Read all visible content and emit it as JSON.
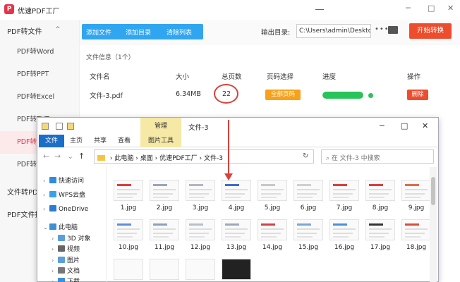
{
  "app": {
    "title": "优速PDF工厂",
    "logo_glyph": "P",
    "brand_color": "#e5344a",
    "window_controls": [
      "─",
      "□",
      "✕"
    ]
  },
  "sidebar": {
    "groups": [
      {
        "label": "PDF转文件",
        "expanded": true
      },
      {
        "label": "文件转PDF"
      },
      {
        "label": "PDF文件操作"
      }
    ],
    "items": [
      {
        "label": "PDF转Word"
      },
      {
        "label": "PDF转PPT"
      },
      {
        "label": "PDF转Excel"
      },
      {
        "label": "PDF转TXT"
      },
      {
        "label": "PDF转图片",
        "active": true
      },
      {
        "label": "PDF转HTML"
      }
    ],
    "chevron": "^"
  },
  "toolbar": {
    "add_file": "添加文件",
    "add_folder": "添加目录",
    "clear_list": "清除列表",
    "output_label": "输出目录:",
    "output_path": "C:\\Users\\admin\\Desktop",
    "more": "•••",
    "start": "开始转换"
  },
  "file_info": {
    "label": "文件信息（1个）",
    "headers": {
      "name": "文件名",
      "size": "大小",
      "pages": "总页数",
      "page_select": "页码选择",
      "progress": "进度",
      "action": "操作"
    },
    "row": {
      "name": "文件-3.pdf",
      "size": "6.34MB",
      "pages": "22",
      "page_select": "全部页码",
      "progress": 1.0,
      "delete": "删除"
    }
  },
  "explorer": {
    "context_tab": "管理",
    "title": "文件-3",
    "ribbon_tabs": [
      "文件",
      "主页",
      "共享",
      "查看",
      "图片工具"
    ],
    "nav": {
      "back": "←",
      "forward": "→",
      "down": "⌄",
      "up": "↑"
    },
    "address": [
      "此电脑",
      "桌面",
      "优速PDF工厂",
      "文件-3"
    ],
    "search_placeholder": "在 文件-3 中搜索",
    "tree": [
      {
        "label": "快速访问",
        "color": "#2f8be0"
      },
      {
        "label": "WPS云盘",
        "color": "#3ba0ea"
      },
      {
        "label": "OneDrive",
        "color": "#2b7cd3"
      },
      {
        "label": "此电脑",
        "color": "#3d8fd6"
      },
      {
        "label": "3D 对象",
        "color": "#5a9fd9"
      },
      {
        "label": "视频",
        "color": "#666"
      },
      {
        "label": "图片",
        "color": "#5a9fd9"
      },
      {
        "label": "文档",
        "color": "#777"
      },
      {
        "label": "下载",
        "color": "#3d8fd6"
      }
    ],
    "files": [
      "1.jpg",
      "2.jpg",
      "3.jpg",
      "4.jpg",
      "5.jpg",
      "6.jpg",
      "7.jpg",
      "8.jpg",
      "9.jpg",
      "10.jpg",
      "11.jpg",
      "12.jpg",
      "13.jpg",
      "14.jpg",
      "15.jpg",
      "16.jpg",
      "17.jpg",
      "18.jpg"
    ],
    "window_controls": [
      "─",
      "□",
      "✕"
    ]
  }
}
